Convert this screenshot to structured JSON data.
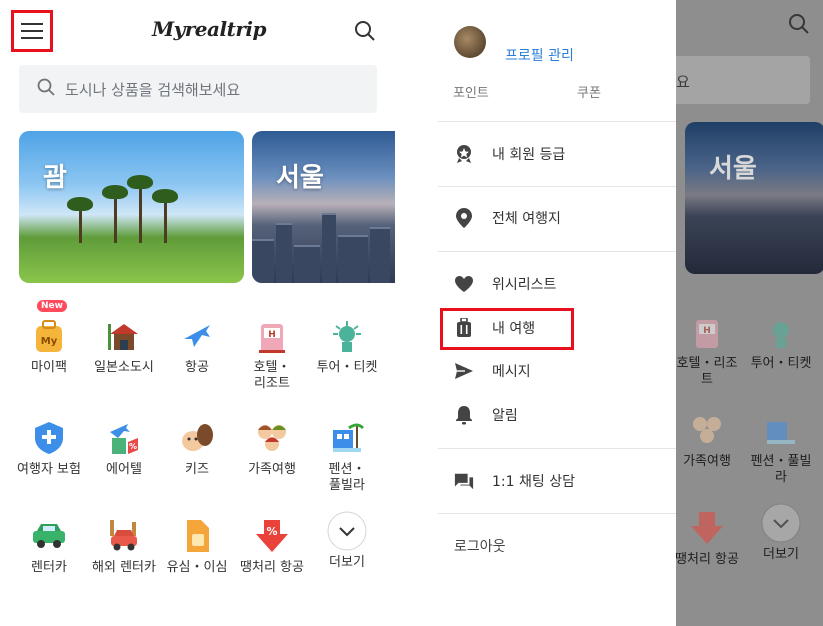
{
  "app": {
    "logo_text": "Myrealtrip"
  },
  "search": {
    "placeholder": "도시나 상품을 검색해보세요"
  },
  "cards": [
    {
      "title": "괌"
    },
    {
      "title": "서울"
    }
  ],
  "categories": [
    {
      "label": "마이팩",
      "icon": "mypack-icon",
      "badge": "New"
    },
    {
      "label": "일본소도시",
      "icon": "japan-town-icon"
    },
    {
      "label": "항공",
      "icon": "airplane-icon"
    },
    {
      "label": "호텔・리조트",
      "icon": "hotel-icon"
    },
    {
      "label": "투어・티켓",
      "icon": "statue-of-liberty-icon"
    },
    {
      "label": "여행자 보험",
      "icon": "insurance-shield-icon"
    },
    {
      "label": "에어텔",
      "icon": "airtel-icon"
    },
    {
      "label": "키즈",
      "icon": "kids-horse-icon"
    },
    {
      "label": "가족여행",
      "icon": "family-icon"
    },
    {
      "label": "펜션・풀빌라",
      "icon": "pension-icon"
    },
    {
      "label": "렌터카",
      "icon": "car-icon"
    },
    {
      "label": "해외 렌터카",
      "icon": "overseas-car-icon"
    },
    {
      "label": "유심・이심",
      "icon": "sim-card-icon"
    },
    {
      "label": "땡처리 항공",
      "icon": "discount-flight-icon"
    },
    {
      "label": "더보기",
      "icon": "chevron-down-icon"
    }
  ],
  "drawer": {
    "profile_link": "프로필 관리",
    "points_label": "포인트",
    "coupons_label": "쿠폰",
    "items": [
      {
        "label": "내 회원 등급",
        "icon": "badge-icon"
      },
      {
        "label": "전체 여행지",
        "icon": "location-pin-icon"
      },
      {
        "label": "위시리스트",
        "icon": "heart-icon"
      },
      {
        "label": "내 여행",
        "icon": "luggage-icon"
      },
      {
        "label": "메시지",
        "icon": "send-icon"
      },
      {
        "label": "알림",
        "icon": "bell-icon"
      },
      {
        "label": "1:1 채팅 상담",
        "icon": "chat-icon"
      }
    ],
    "logout_label": "로그아웃"
  },
  "overlay": {
    "search_glyph": "요",
    "card_title": "서울",
    "categories": [
      {
        "label": "호텔・리조트",
        "icon": "hotel-icon"
      },
      {
        "label": "투어・티켓",
        "icon": "statue-of-liberty-icon"
      },
      {
        "label": "가족여행",
        "icon": "family-icon"
      },
      {
        "label": "펜션・풀빌라",
        "icon": "pension-icon"
      },
      {
        "label": "땡처리 항공",
        "icon": "discount-flight-icon"
      },
      {
        "label": "더보기",
        "icon": "chevron-down-icon"
      }
    ]
  },
  "colors": {
    "highlight": "#e8101c",
    "link": "#2b7fd8",
    "overlay": "#8e8e8e"
  }
}
